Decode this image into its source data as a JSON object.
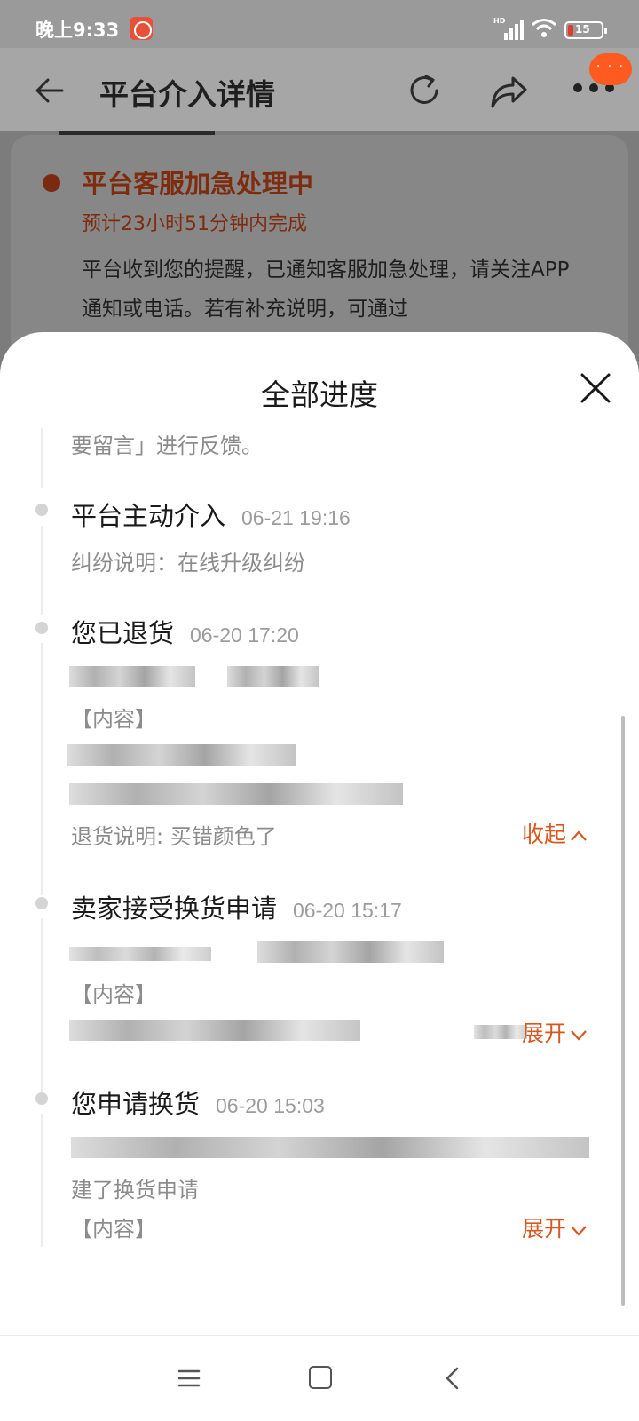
{
  "status_bar": {
    "time": "晚上9:33",
    "signal_label": "HD",
    "battery_level": "15"
  },
  "header": {
    "title": "平台介入详情",
    "more_badge": "· · ·"
  },
  "background_card": {
    "status_title": "平台客服加急处理中",
    "eta": "预计23小时51分钟内完成",
    "description": "平台收到您的提醒，已通知客服加急处理，请关注APP通知或电话。若有补充说明，可通过"
  },
  "sheet": {
    "title": "全部进度",
    "partial_text": "要留言」进行反馈。",
    "events": [
      {
        "title": "平台主动介入",
        "time": "06-21 19:16",
        "note": "纠纷说明：在线升级纠纷"
      },
      {
        "title": "您已退货",
        "time": "06-20 17:20",
        "content_label": "【内容】",
        "note": "退货说明: 买错颜色了",
        "toggle": "收起"
      },
      {
        "title": "卖家接受换货申请",
        "time": "06-20 15:17",
        "content_label": "【内容】",
        "toggle": "展开"
      },
      {
        "title": "您申请换货",
        "time": "06-20 15:03",
        "note": "建了换货申请",
        "content_label": "【内容】",
        "toggle": "展开"
      }
    ]
  },
  "colors": {
    "accent": "#d8571f",
    "badge": "#ff5a1f",
    "status_dark": "#7e2c10"
  },
  "icons": [
    "back-arrow-icon",
    "refresh-icon",
    "share-icon",
    "more-icon",
    "close-icon",
    "chevron-up-icon",
    "chevron-down-icon",
    "menu-icon",
    "home-icon",
    "back-icon"
  ]
}
